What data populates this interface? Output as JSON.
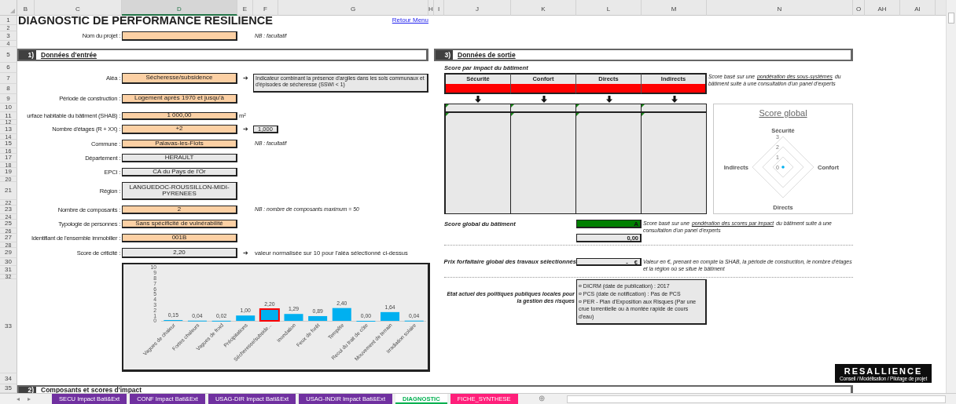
{
  "column_headers": [
    {
      "label": "B",
      "selected": false
    },
    {
      "label": "C",
      "selected": false
    },
    {
      "label": "D",
      "selected": true
    },
    {
      "label": "E",
      "selected": false
    },
    {
      "label": "F",
      "selected": false
    },
    {
      "label": "G",
      "selected": false
    },
    {
      "label": "H",
      "selected": false
    },
    {
      "label": "I",
      "selected": false
    },
    {
      "label": "J",
      "selected": false
    },
    {
      "label": "K",
      "selected": false
    },
    {
      "label": "L",
      "selected": false
    },
    {
      "label": "M",
      "selected": false
    },
    {
      "label": "N",
      "selected": false
    },
    {
      "label": "O",
      "selected": false
    },
    {
      "label": "AH",
      "selected": false
    },
    {
      "label": "AI",
      "selected": false
    }
  ],
  "row_numbers": [
    "1",
    "2",
    "3",
    "4",
    "5",
    "6",
    "7",
    "8",
    "9",
    "10",
    "11",
    "12",
    "13",
    "14",
    "15",
    "16",
    "17",
    "18",
    "19",
    "20",
    "21",
    "22",
    "23",
    "24",
    "25",
    "26",
    "27",
    "28",
    "29",
    "30",
    "31",
    "32",
    "33",
    "34",
    "35"
  ],
  "title": "DIAGNOSTIC DE PERFORMANCE RESILIENCE",
  "back_link": "Retour Menu",
  "project": {
    "label": "Nom du projet :",
    "note": "NB : facultatif"
  },
  "input_section": {
    "number": "1)",
    "title": "Données d'entrée",
    "fields": [
      {
        "label": "Aléa :",
        "value": "Sécheresse/subsidence",
        "kind": "input",
        "arrow": "➔",
        "info": "Indicateur combinant la présence d'argiles dans les sols communaux et d'épisodes de sécheresse (SSWI < 1)"
      },
      {
        "label": "Période de construction :",
        "value": "Logement après 1970 et jusqu'à",
        "kind": "input"
      },
      {
        "label": "urface habitable du bâtiment (SHAB) :",
        "value": "1 000,00",
        "kind": "input",
        "unit": "m²"
      },
      {
        "label": "Nombre d'étages (R + XX) :",
        "value": "+2",
        "kind": "input",
        "arrow": "➔",
        "side_value": "1,000"
      },
      {
        "label": "Commune :",
        "value": "Palavas-les-Flots",
        "kind": "input",
        "note": "NB : facultatif"
      },
      {
        "label": "Département :",
        "value": "HERAULT",
        "kind": "computed"
      },
      {
        "label": "EPCI :",
        "value": "CA du Pays de l'Or",
        "kind": "computed"
      },
      {
        "label": "Région :",
        "value": "LANGUEDOC-ROUSSILLON-MIDI-PYRENEES",
        "kind": "computed"
      },
      {
        "label": "Nombre de composants :",
        "value": "2",
        "kind": "input",
        "note": "NB : nombre de composants maximum = 50"
      },
      {
        "label": "Typologie de personnes :",
        "value": "Sans spécificité de vulnérabilité",
        "kind": "input"
      },
      {
        "label": "Identifiant de l'ensemble immobilier :",
        "value": "001B",
        "kind": "input"
      },
      {
        "label": "Score de criticité :",
        "value": "2,20",
        "kind": "computed",
        "arrow": "➔",
        "remark": "valeur normalisée sur 10 pour l'aléa sélectionné ci-dessus"
      }
    ]
  },
  "criticity_chart": {
    "chart_data": {
      "type": "bar",
      "categories": [
        "Vagues de chaleur",
        "Fortes chaleurs",
        "Vagues de froid",
        "Précipitations",
        "Sécheresse/subside...",
        "Inondation",
        "Feux de forêt",
        "Tempête",
        "Recul du trait de côte",
        "Mouvement de terrain",
        "Irradiation solaire"
      ],
      "values": [
        0.15,
        0.04,
        0.02,
        1.0,
        2.2,
        1.29,
        0.89,
        2.4,
        0.0,
        1.64,
        0.04
      ],
      "ylim": [
        0,
        10
      ],
      "yticks": [
        0,
        1,
        2,
        3,
        4,
        5,
        6,
        7,
        8,
        9,
        10
      ],
      "value_labels": [
        "0,15",
        "0,04",
        "0,02",
        "1,00",
        "2,20",
        "1,29",
        "0,89",
        "2,40",
        "0,00",
        "1,64",
        "0,04"
      ]
    },
    "bars": [
      {
        "selected": false
      },
      {
        "selected": false
      },
      {
        "selected": false
      },
      {
        "selected": false
      },
      {
        "selected": true
      },
      {
        "selected": false
      },
      {
        "selected": false
      },
      {
        "selected": false
      },
      {
        "selected": false
      },
      {
        "selected": false
      },
      {
        "selected": false
      }
    ]
  },
  "output_section": {
    "number": "3)",
    "title": "Données de sortie",
    "impact_table": {
      "title": "Score par impact du bâtiment",
      "columns": [
        {
          "name": "Sécurité",
          "color": "#ff0000"
        },
        {
          "name": "Confort",
          "color": "#ff0000"
        },
        {
          "name": "Directs",
          "color": "#ff0000"
        },
        {
          "name": "Indirects",
          "color": "#ff0000"
        }
      ],
      "note": {
        "before": "Score basé sur une",
        "underlined": "pondération des sous-systèmes",
        "after": "du bâtiment suite à une consultation d'un panel d'experts"
      }
    },
    "radar": {
      "title": "Score global",
      "ticks": [
        "3",
        "2",
        "1",
        "0"
      ],
      "axes": [
        {
          "name": "Sécurité"
        },
        {
          "name": "Confort"
        },
        {
          "name": "Directs"
        },
        {
          "name": "Indirects"
        }
      ]
    },
    "score_global": {
      "label": "Score global du bâtiment",
      "grade": "A",
      "color": "#008000",
      "value": "0,00",
      "note": {
        "before": "Score basé sur une",
        "underlined": "pondération des scores par impact",
        "after": "du bâtiment suite à une consultation d'un panel d'experts"
      }
    },
    "price": {
      "label": "Prix forfaitaire global des travaux sélectionnés",
      "value": "-",
      "currency": "€",
      "note": "Valeur en €, prenant en compte la SHAB, la période de construction, le nombre d'étages et la région où se situe le bâtiment"
    },
    "policies": {
      "label": "Etat actuel des politiques publiques locales pour la gestion des risques",
      "items": [
        "¤ DICRM (date de publication) : 2017",
        "¤ PCS (date de notification) : Pas de PCS",
        "¤ PER - Plan d'Exposition aux Risques (Par une crue torrentielle ou à montée rapide de cours d'eau)"
      ]
    },
    "logo": {
      "name": "RESALLIENCE",
      "tagline": "Conseil / Modélisation / Pilotage de projet"
    }
  },
  "components_section": {
    "number": "2)",
    "title": "Composants et scores d'impact"
  },
  "sheet_tabs": {
    "nav": [
      "◂",
      "▸"
    ],
    "tabs": [
      {
        "label": "SECU Impact Bati&Ext",
        "color": "#7030a0",
        "selected": false
      },
      {
        "label": "CONF Impact Bati&Ext",
        "color": "#7030a0",
        "selected": false
      },
      {
        "label": "USAG-DIR Impact Bati&Ext",
        "color": "#7030a0",
        "selected": false
      },
      {
        "label": "USAG-INDIR Impact Bati&Ext",
        "color": "#7030a0",
        "selected": false
      },
      {
        "label": "DIAGNOSTIC",
        "color": "#00b050",
        "selected": true
      },
      {
        "label": "FICHE_SYNTHESE",
        "color": "#ff1f7a",
        "selected": false
      }
    ],
    "add": "⊕"
  }
}
